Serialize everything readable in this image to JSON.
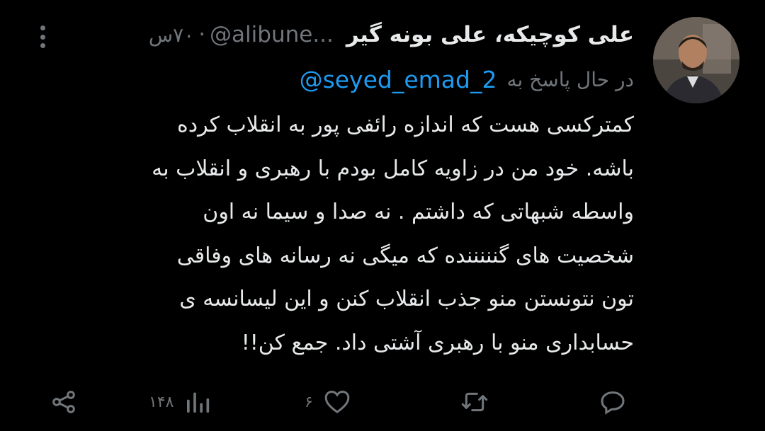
{
  "author": {
    "name": "علی کوچیکه، علی بونه گیر",
    "handle": "@alibune...",
    "time": "۷۰س",
    "separator": "·"
  },
  "reply": {
    "prefix": "در حال پاسخ به",
    "to": "@seyed_emad_2"
  },
  "body_lines": [
    "کمترکسی هست که اندازه رائفی پور به انقلاب کرده",
    "باشه. خود من در زاویه کامل بودم با رهبری و انقلاب به",
    "واسطه شبهاتی که داشتم . نه صدا و سیما نه اون",
    "شخصیت های گنننننده که میگی نه رسانه های وفاقی",
    "تون نتونستن منو جذب انقلاب کنن و این لیسانسه ی",
    "حسابداری منو با رهبری آشتی داد. جمع کن!!"
  ],
  "actions": {
    "views": "۱۴۸",
    "likes": "۶"
  },
  "icons": {
    "avatar": "avatar-photo",
    "more": "more-vertical-icon",
    "share": "share-icon",
    "views": "bar-chart-icon",
    "like": "heart-icon",
    "retweet": "retweet-icon",
    "reply": "reply-bubble-icon"
  },
  "colors": {
    "background": "#000000",
    "text": "#e7e9ea",
    "muted": "#71767b",
    "link": "#1d9bf0"
  }
}
